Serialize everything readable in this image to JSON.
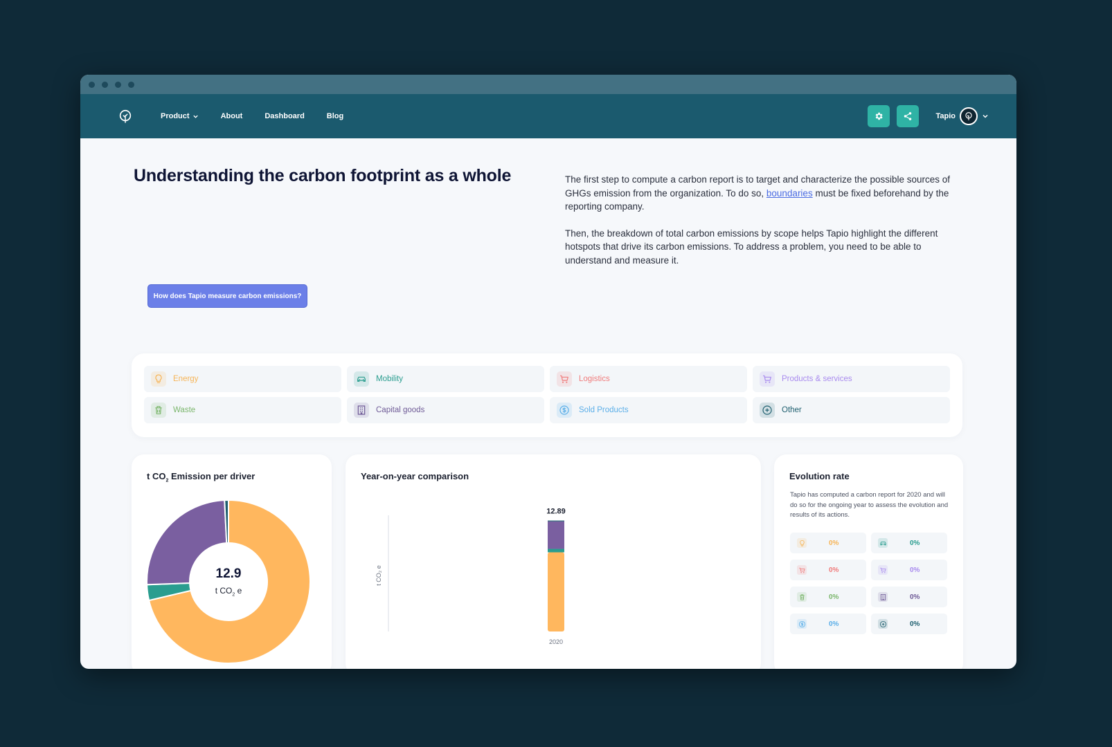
{
  "nav": {
    "items": [
      {
        "label": "Product",
        "has_dropdown": true
      },
      {
        "label": "About"
      },
      {
        "label": "Dashboard"
      },
      {
        "label": "Blog"
      }
    ],
    "user_name": "Tapio",
    "icons": [
      "settings-icon",
      "share-icon"
    ]
  },
  "hero": {
    "title": "Understanding the carbon footprint as a whole",
    "intro_p1_before": "The first step to compute a carbon report is to target and characterize the possible sources of GHGs emission from the organization. To do so, ",
    "intro_p1_link": "boundaries",
    "intro_p1_after": " must be fixed beforehand by the reporting company.",
    "intro_p2": "Then, the breakdown of total carbon emissions by scope helps Tapio highlight the different hotspots that drive its carbon emissions. To address a problem, you need to be able to understand and measure it.",
    "cta_label": "How does Tapio measure carbon emissions?"
  },
  "filters": [
    {
      "label": "Energy",
      "icon": "lightbulb-icon",
      "color": "#f6b456"
    },
    {
      "label": "Mobility",
      "icon": "car-icon",
      "color": "#2a9d8f"
    },
    {
      "label": "Logistics",
      "icon": "truck-icon",
      "color": "#f07b7b"
    },
    {
      "label": "Products & services",
      "icon": "cart-icon",
      "color": "#a98bee"
    },
    {
      "label": "Waste",
      "icon": "trash-icon",
      "color": "#7bb66c"
    },
    {
      "label": "Capital goods",
      "icon": "building-icon",
      "color": "#6e5a96"
    },
    {
      "label": "Sold Products",
      "icon": "dollar-icon",
      "color": "#5aaee8"
    },
    {
      "label": "Other",
      "icon": "plus-circle-icon",
      "color": "#1d5e6e"
    }
  ],
  "driver_card": {
    "title_prefix": "t CO",
    "title_sub": "2",
    "title_suffix": " Emission per driver",
    "total": "12.9",
    "unit_prefix": "t CO",
    "unit_sub": "2",
    "unit_suffix": " e"
  },
  "yoy_card": {
    "title": "Year-on-year comparison",
    "ylabel": "t CO₂ e"
  },
  "evolution": {
    "title": "Evolution rate",
    "description": "Tapio has computed a carbon report for 2020 and will do so for the ongoing year to assess the evolution and results of its actions.",
    "rates": [
      {
        "icon": "lightbulb-icon",
        "value": "0%",
        "color": "#f6b456"
      },
      {
        "icon": "car-icon",
        "value": "0%",
        "color": "#2a9d8f"
      },
      {
        "icon": "truck-icon",
        "value": "0%",
        "color": "#f07b7b"
      },
      {
        "icon": "cart-icon",
        "value": "0%",
        "color": "#a98bee"
      },
      {
        "icon": "trash-icon",
        "value": "0%",
        "color": "#7bb66c"
      },
      {
        "icon": "building-icon",
        "value": "0%",
        "color": "#6e5a96"
      },
      {
        "icon": "dollar-icon",
        "value": "0%",
        "color": "#5aaee8"
      },
      {
        "icon": "plus-circle-icon",
        "value": "0%",
        "color": "#1d5e6e"
      }
    ]
  },
  "chart_data": [
    {
      "type": "pie",
      "title": "t CO₂ Emission per driver",
      "center_label": "12.9",
      "slices": [
        {
          "category": "Energy",
          "value": 9.2,
          "color": "#ffb75e"
        },
        {
          "category": "Mobility",
          "value": 0.4,
          "color": "#2a9d8f"
        },
        {
          "category": "Capital goods",
          "value": 3.2,
          "color": "#7a5fa0"
        },
        {
          "category": "Other",
          "value": 0.1,
          "color": "#1d5e6e"
        }
      ]
    },
    {
      "type": "bar",
      "title": "Year-on-year comparison",
      "categories": [
        "2020"
      ],
      "ylabel": "t CO₂ e",
      "stacked": true,
      "total_label": "12.89",
      "series": [
        {
          "name": "Energy",
          "values": [
            9.2
          ],
          "color": "#ffb75e"
        },
        {
          "name": "Mobility",
          "values": [
            0.4
          ],
          "color": "#2a9d8f"
        },
        {
          "name": "Capital goods",
          "values": [
            3.2
          ],
          "color": "#7a5fa0"
        },
        {
          "name": "Other",
          "values": [
            0.09
          ],
          "color": "#1d5e6e"
        }
      ]
    }
  ]
}
